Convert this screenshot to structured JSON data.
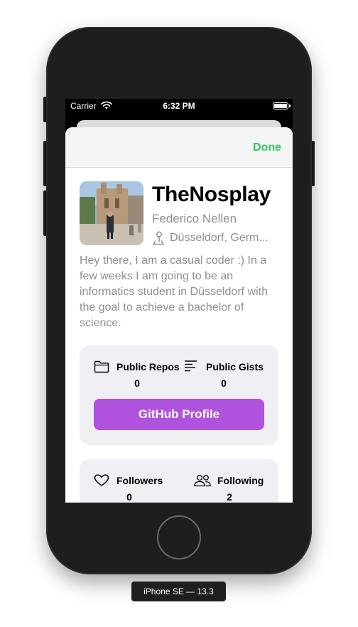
{
  "status_bar": {
    "carrier": "Carrier",
    "time": "6:32 PM"
  },
  "nav": {
    "done_label": "Done"
  },
  "profile": {
    "username": "TheNosplay",
    "full_name": "Federico Nellen",
    "location": "Düsseldorf, Germ...",
    "bio": "Hey there, I am a casual coder :) In a few weeks I am going to be an informatics student in Düsseldorf with the goal to achieve a bachelor of science."
  },
  "stats": {
    "public_repos_label": "Public Repos",
    "public_repos_value": "0",
    "public_gists_label": "Public Gists",
    "public_gists_value": "0",
    "github_button_label": "GitHub Profile"
  },
  "social": {
    "followers_label": "Followers",
    "followers_value": "0",
    "following_label": "Following",
    "following_value": "2"
  },
  "device": {
    "label": "iPhone SE — 13.3"
  },
  "colors": {
    "accent_green": "#34c759",
    "button_purple": "#af52de",
    "card_bg": "#efeff4"
  }
}
